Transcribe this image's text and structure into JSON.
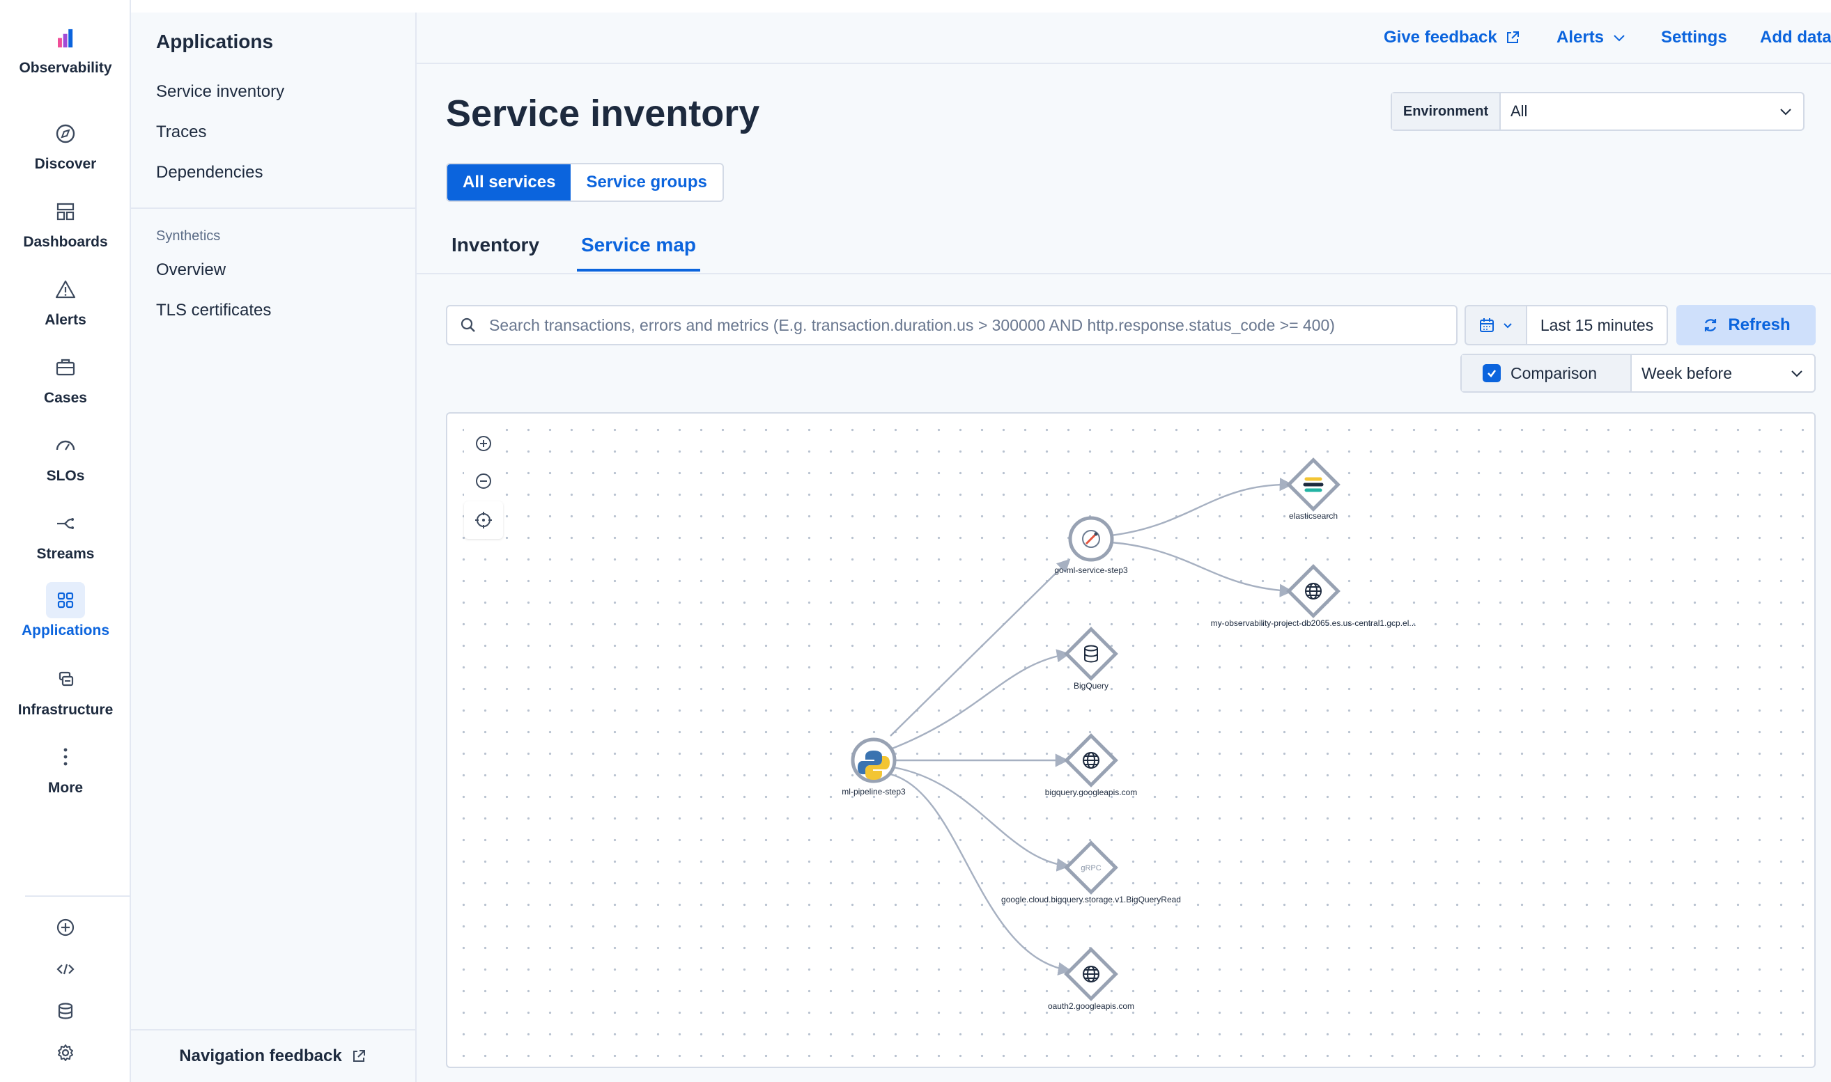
{
  "rail": {
    "brand_label": "Observability",
    "items": [
      {
        "label": "Discover",
        "icon": "compass-icon"
      },
      {
        "label": "Dashboards",
        "icon": "dashboard-icon"
      },
      {
        "label": "Alerts",
        "icon": "warning-icon"
      },
      {
        "label": "Cases",
        "icon": "briefcase-icon"
      },
      {
        "label": "SLOs",
        "icon": "gauge-icon"
      },
      {
        "label": "Streams",
        "icon": "streams-icon"
      },
      {
        "label": "Applications",
        "icon": "grid-icon",
        "active": true
      },
      {
        "label": "Infrastructure",
        "icon": "infrastructure-icon"
      },
      {
        "label": "More",
        "icon": "more-dots-icon"
      }
    ],
    "tools": [
      "plus-circle-icon",
      "code-icon",
      "database-icon",
      "gear-icon"
    ]
  },
  "secondary_nav": {
    "title": "Applications",
    "links": [
      "Service inventory",
      "Traces",
      "Dependencies"
    ],
    "group_label": "Synthetics",
    "group_links": [
      "Overview",
      "TLS certificates"
    ],
    "footer_label": "Navigation feedback"
  },
  "header": {
    "give_feedback": "Give feedback",
    "alerts": "Alerts",
    "settings": "Settings",
    "add_data": "Add data"
  },
  "page": {
    "title": "Service inventory",
    "environment_label": "Environment",
    "environment_value": "All",
    "segments": [
      "All services",
      "Service groups"
    ],
    "tabs": [
      "Inventory",
      "Service map"
    ],
    "active_tab": "Service map",
    "search_placeholder": "Search transactions, errors and metrics (E.g. transaction.duration.us > 300000 AND http.response.status_code >= 400)",
    "date_range": "Last 15 minutes",
    "refresh_label": "Refresh",
    "comparison_label": "Comparison",
    "comparison_checked": true,
    "comparison_value": "Week before"
  },
  "service_map": {
    "nodes": [
      {
        "label": "ml-pipeline-step3",
        "kind": "service",
        "icon": "python-icon"
      },
      {
        "label": "go-ml-service-step3",
        "kind": "service",
        "icon": "go-icon"
      },
      {
        "label": "elasticsearch",
        "kind": "dependency",
        "icon": "elasticsearch-icon"
      },
      {
        "label": "my-observability-project-db2065.es.us-central1.gcp.el...",
        "kind": "dependency",
        "icon": "globe-icon"
      },
      {
        "label": "BigQuery",
        "kind": "dependency",
        "icon": "database-icon"
      },
      {
        "label": "bigquery.googleapis.com",
        "kind": "dependency",
        "icon": "globe-icon"
      },
      {
        "label": "google.cloud.bigquery.storage.v1.BigQueryRead",
        "kind": "dependency",
        "icon": "grpc-icon"
      },
      {
        "label": "oauth2.googleapis.com",
        "kind": "dependency",
        "icon": "globe-icon"
      }
    ],
    "edges": [
      [
        "ml-pipeline-step3",
        "go-ml-service-step3"
      ],
      [
        "ml-pipeline-step3",
        "BigQuery"
      ],
      [
        "ml-pipeline-step3",
        "bigquery.googleapis.com"
      ],
      [
        "ml-pipeline-step3",
        "google.cloud.bigquery.storage.v1.BigQueryRead"
      ],
      [
        "ml-pipeline-step3",
        "oauth2.googleapis.com"
      ],
      [
        "go-ml-service-step3",
        "elasticsearch"
      ],
      [
        "go-ml-service-step3",
        "my-observability-project-db2065.es.us-central1.gcp.el..."
      ]
    ],
    "grpc_badge": "gRPC"
  },
  "colors": {
    "accent": "#0b64dd",
    "node_border": "#98a2b3",
    "edge": "#a6b0c1",
    "brand_pink": "#f04e98",
    "brand_blue": "#0b64dd"
  }
}
